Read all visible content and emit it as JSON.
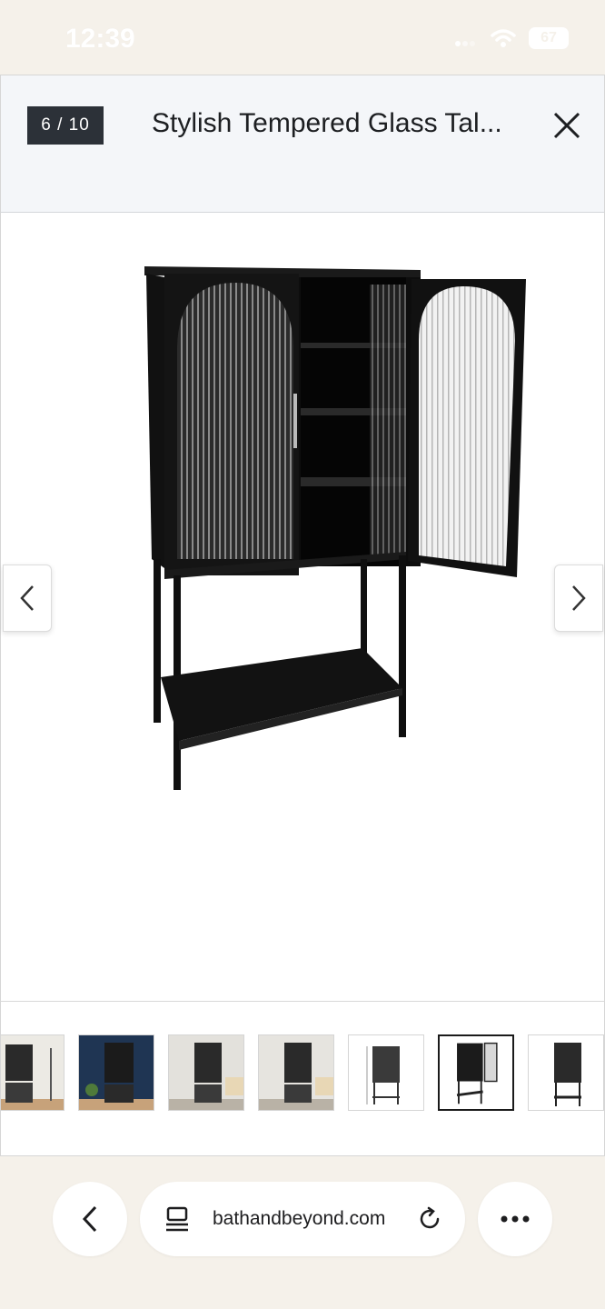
{
  "status_bar": {
    "time": "12:39",
    "battery": "67"
  },
  "modal": {
    "counter": "6 / 10",
    "title": "Stylish Tempered Glass Tal..."
  },
  "product_image": {
    "alt": "Black metal cabinet with fluted glass arched doors, one door open"
  },
  "thumbnails": [
    {
      "alt": "Cabinet in room with lamp"
    },
    {
      "alt": "Cabinet against navy wall"
    },
    {
      "alt": "Cabinet in living room with sofa"
    },
    {
      "alt": "Cabinet in living room with sofa"
    },
    {
      "alt": "Cabinet dimensions diagram"
    },
    {
      "alt": "Cabinet with door open"
    },
    {
      "alt": "Cabinet side view"
    }
  ],
  "thumbnail_active_index": 5,
  "browser": {
    "url": "bathandbeyond.com"
  },
  "colors": {
    "badge_bg": "#2c3138",
    "header_bg": "#f4f6f9",
    "browser_bg": "#f5f1ea"
  }
}
